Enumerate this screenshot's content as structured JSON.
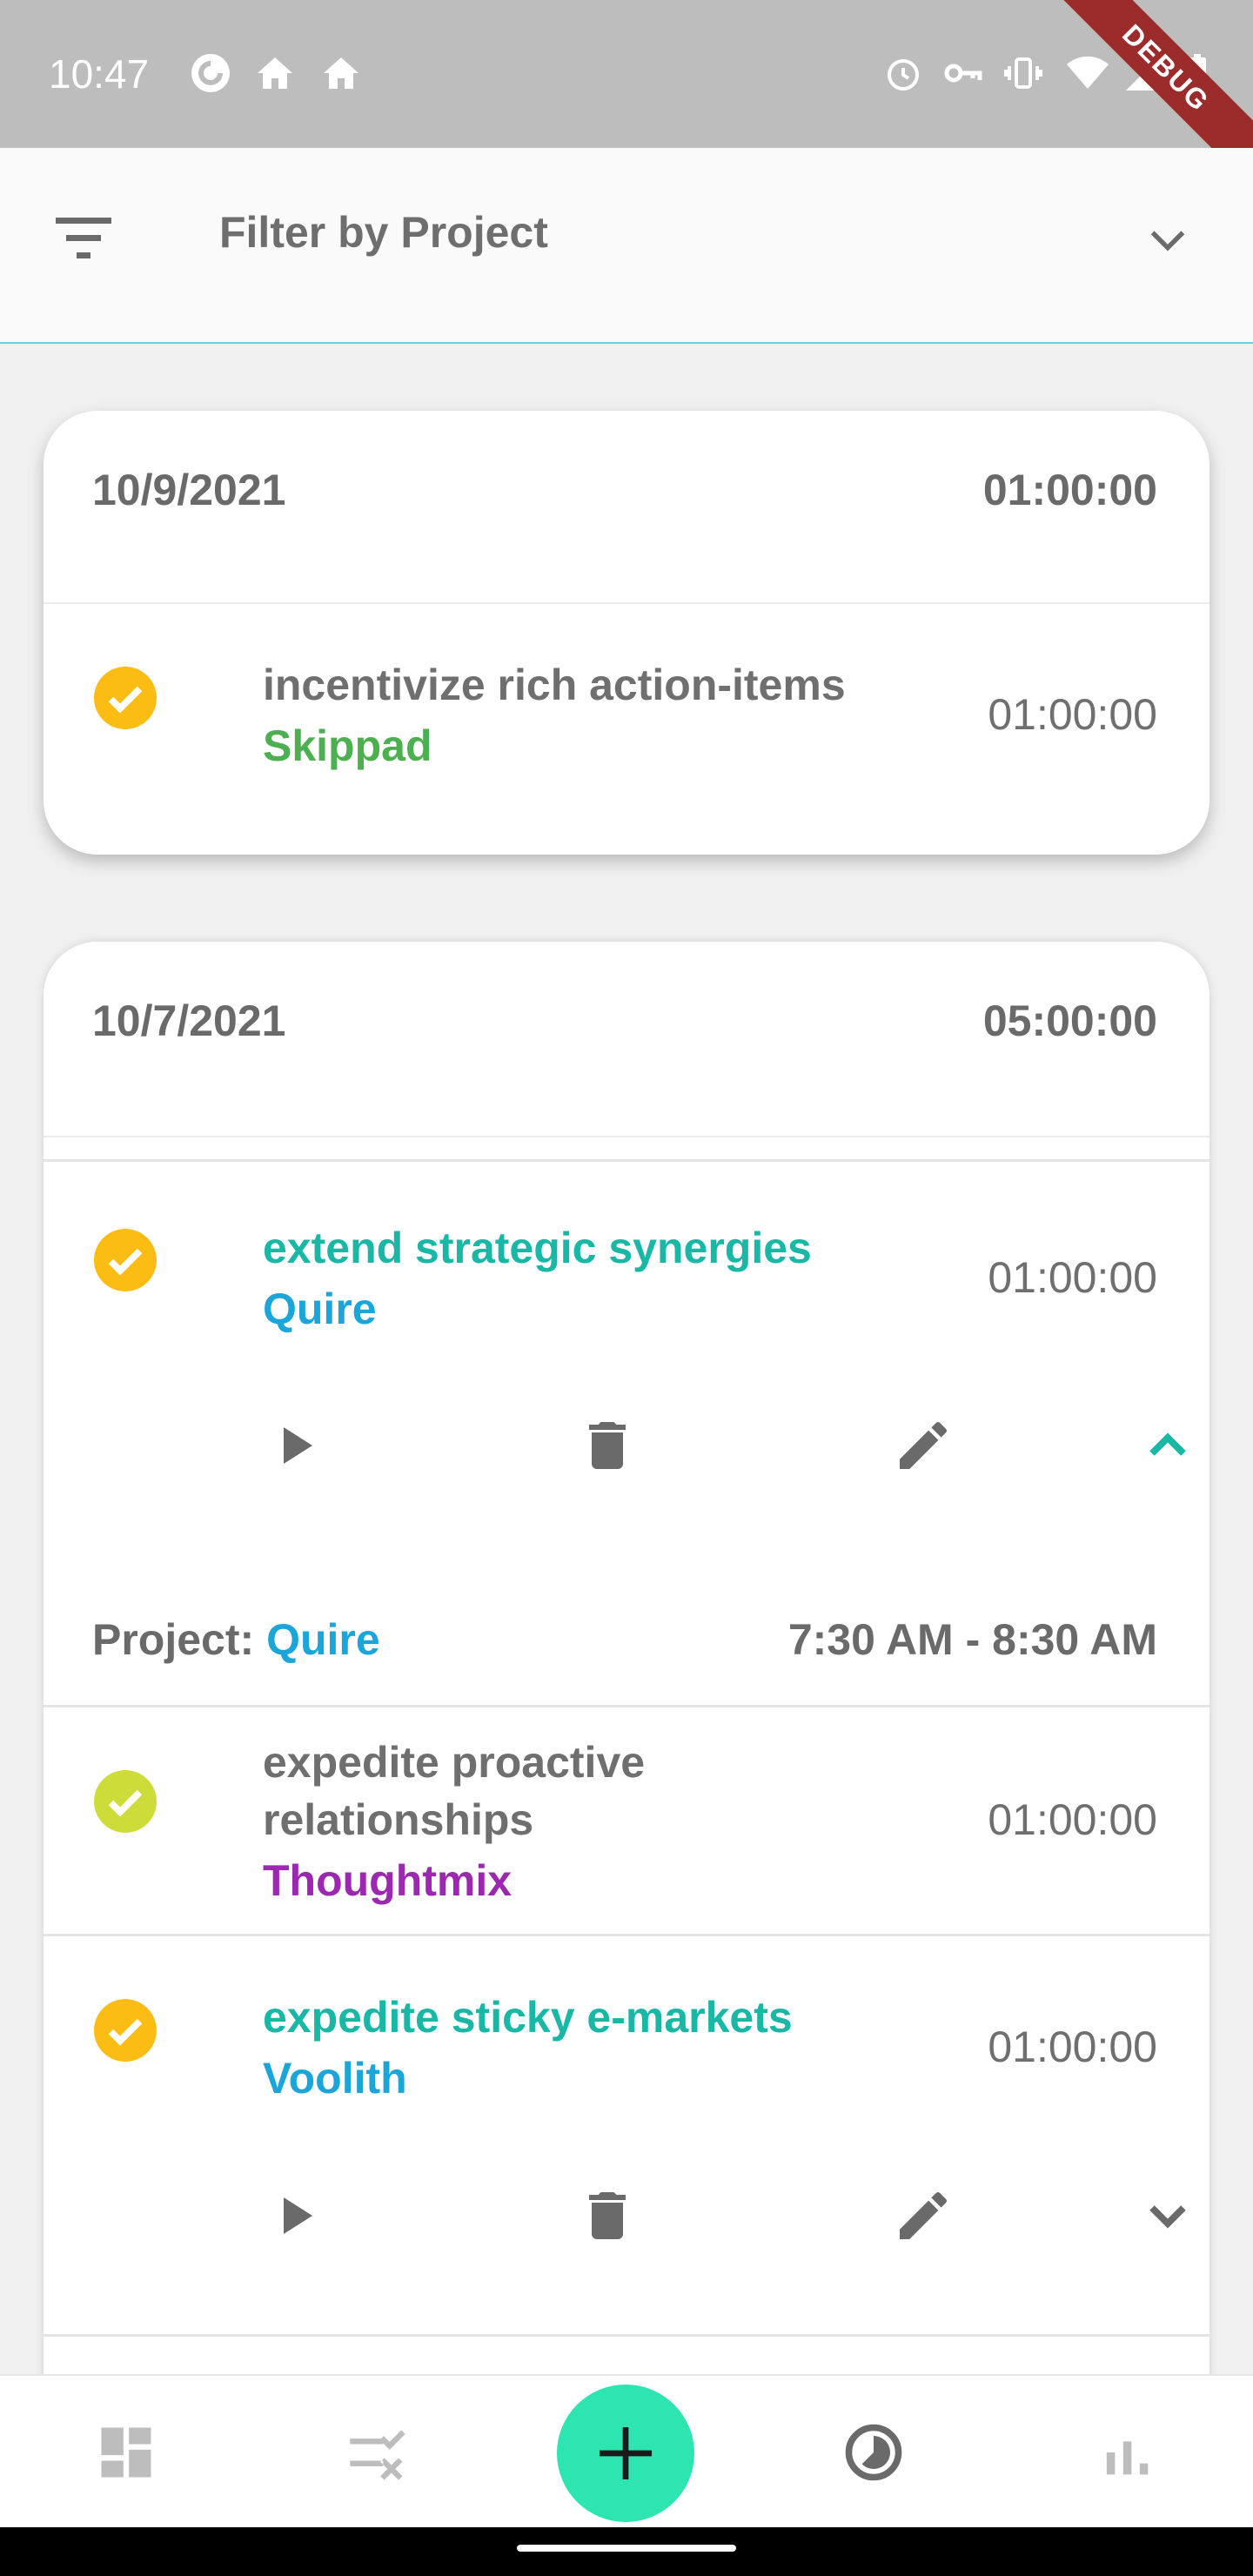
{
  "status": {
    "time": "10:47",
    "banner": "DEBUG",
    "icons": [
      "pocket-casts-icon",
      "home-icon",
      "home-icon",
      "alarm-icon",
      "vpn-key-icon",
      "vibrate-icon",
      "wifi-icon",
      "signal-icon",
      "battery-icon"
    ]
  },
  "filter": {
    "label": "Filter by Project",
    "icon": "filter-list-icon",
    "chevron": "chevron-down-icon"
  },
  "colors": {
    "accent": "#2de5b0",
    "teal": "#19b7a6",
    "cyan": "#1ba5d8",
    "green": "#4caf50",
    "purple": "#9c27b0",
    "check_orange": "#fbbd14",
    "check_lime": "#cddc39"
  },
  "days": [
    {
      "date": "10/9/2021",
      "total": "01:00:00",
      "entries": [
        {
          "title": "incentivize rich action-items",
          "project": "Skippad",
          "duration": "01:00:00"
        }
      ]
    },
    {
      "date": "10/7/2021",
      "total": "05:00:00",
      "entries": [
        {
          "title": "extend strategic synergies",
          "project": "Quire",
          "duration": "01:00:00",
          "detail_label": "Project: ",
          "detail_project": "Quire",
          "detail_range": "7:30 AM - 8:30 AM"
        },
        {
          "title": "expedite proactive relationships",
          "project": "Thoughtmix",
          "duration": "01:00:00"
        },
        {
          "title": "expedite sticky e-markets",
          "project": "Voolith",
          "duration": "01:00:00"
        }
      ]
    }
  ],
  "nav": {
    "items": [
      "dashboard-icon",
      "tasks-icon",
      "add-icon",
      "timer-icon",
      "stats-icon"
    ]
  }
}
